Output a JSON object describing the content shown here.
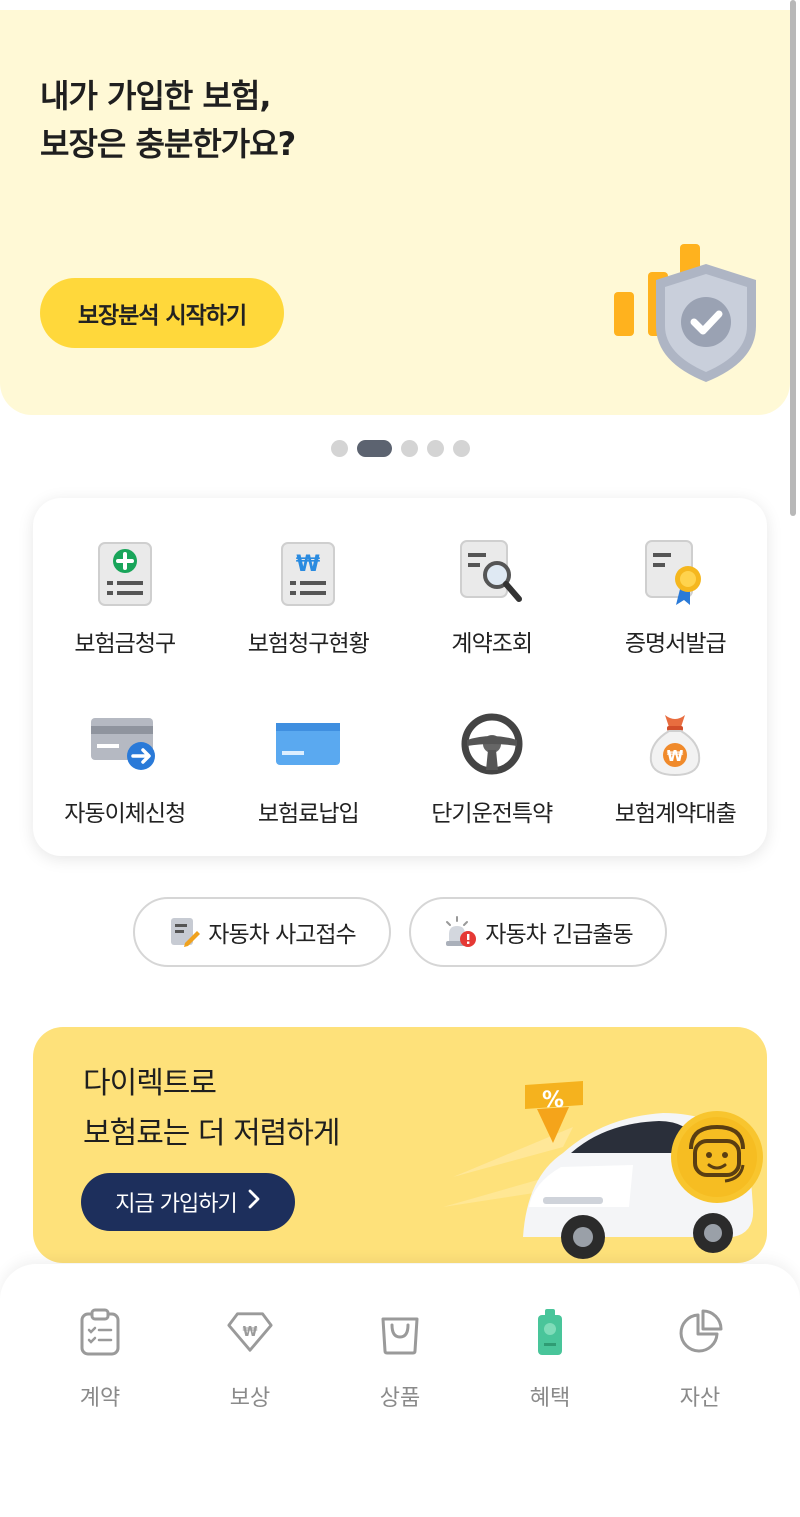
{
  "top_banner": {
    "title_line1": "내가 가입한 보험,",
    "title_line2": "보장은 충분한가요?",
    "button_label": "보장분석 시작하기"
  },
  "carousel": {
    "total": 5,
    "active_index": 1
  },
  "menu": {
    "items": [
      {
        "label": "보험금청구",
        "icon": "claim-plus-document-icon"
      },
      {
        "label": "보험청구현황",
        "icon": "won-document-icon"
      },
      {
        "label": "계약조회",
        "icon": "document-search-icon"
      },
      {
        "label": "증명서발급",
        "icon": "certificate-badge-icon"
      },
      {
        "label": "자동이체신청",
        "icon": "card-transfer-icon"
      },
      {
        "label": "보험료납입",
        "icon": "blue-card-icon"
      },
      {
        "label": "단기운전특약",
        "icon": "steering-wheel-icon"
      },
      {
        "label": "보험계약대출",
        "icon": "money-bag-icon"
      }
    ]
  },
  "quick_actions": [
    {
      "label": "자동차 사고접수",
      "icon": "report-pencil-icon"
    },
    {
      "label": "자동차 긴급출동",
      "icon": "emergency-siren-icon"
    }
  ],
  "promo": {
    "title_line1": "다이렉트로",
    "title_line2": "보험료는 더 저렴하게",
    "button_label": "지금 가입하기"
  },
  "bottom_nav": [
    {
      "label": "계약",
      "icon": "clipboard-icon",
      "active": false
    },
    {
      "label": "보상",
      "icon": "diamond-won-icon",
      "active": false
    },
    {
      "label": "상품",
      "icon": "shopping-bag-icon",
      "active": false
    },
    {
      "label": "혜택",
      "icon": "gift-phone-icon",
      "active": false
    },
    {
      "label": "자산",
      "icon": "pie-chart-icon",
      "active": false
    }
  ],
  "colors": {
    "banner_bg": "#fff9d6",
    "banner_button": "#ffd83b",
    "promo_bg": "#fee17a",
    "promo_button": "#1d2f5c",
    "benefit_icon": "#49c59a"
  }
}
